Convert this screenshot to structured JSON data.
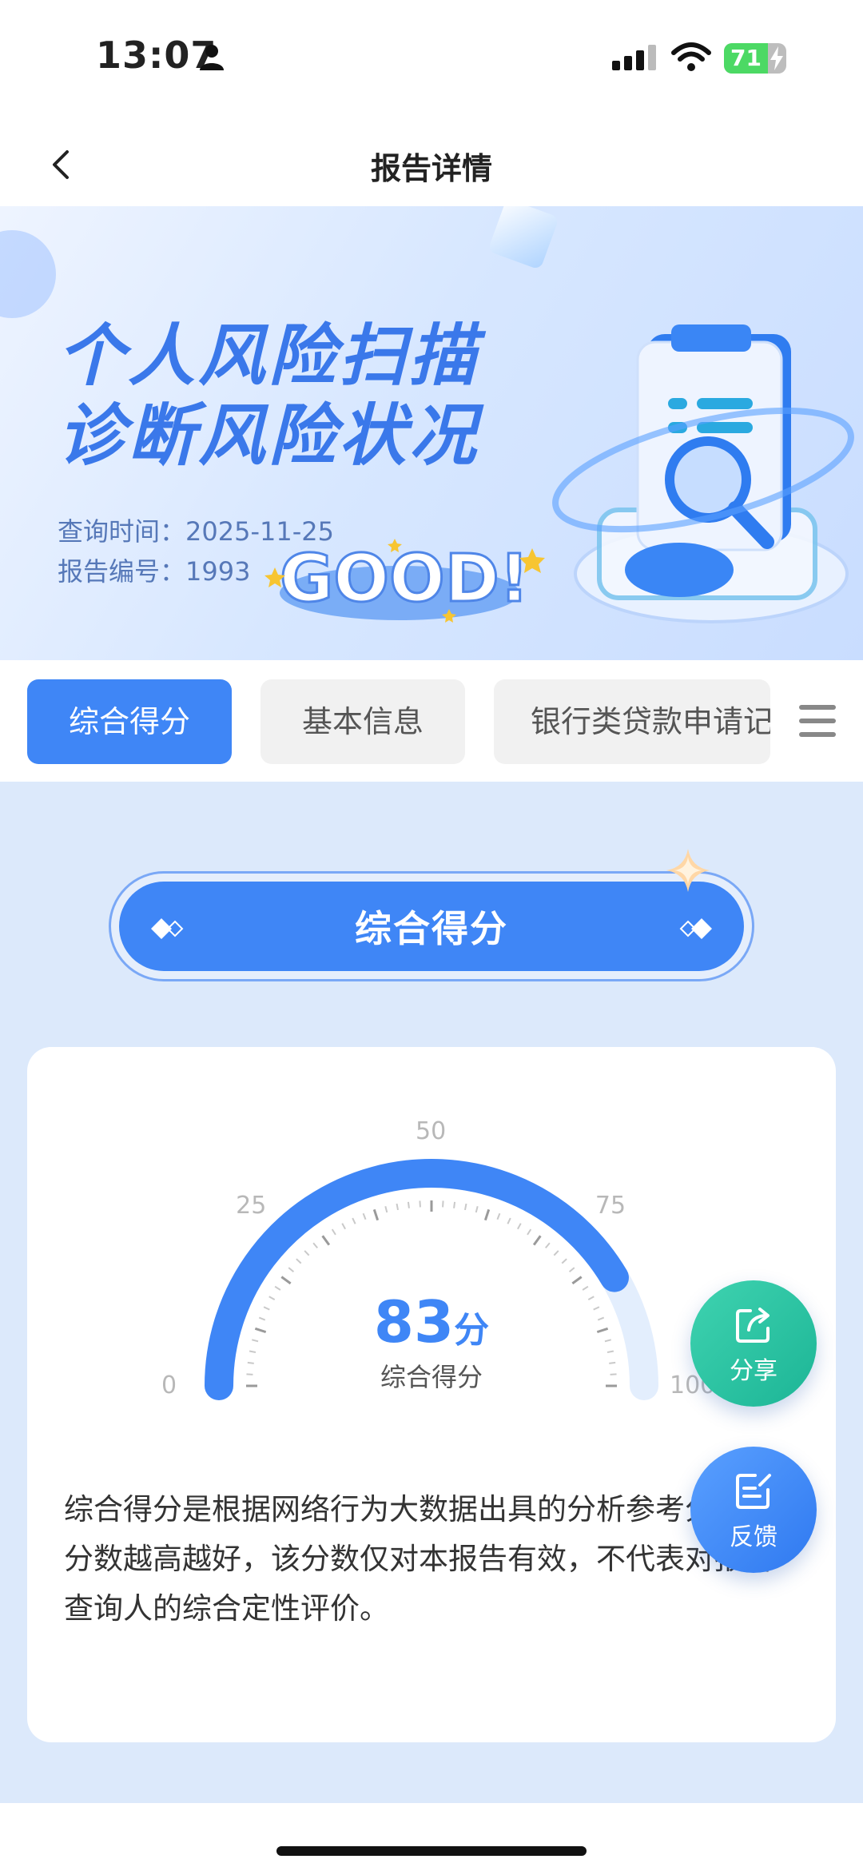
{
  "status_bar": {
    "time": "13:07",
    "battery": "71",
    "battery_level": 0.71
  },
  "nav": {
    "title": "报告详情"
  },
  "banner": {
    "headline_line1": "个人风险扫描",
    "headline_line2": "诊断风险状况",
    "query_time": "查询时间：2025-11-25",
    "report_no": "报告编号：1993",
    "badge_text": "GOOD!"
  },
  "tabs": [
    {
      "label": "综合得分",
      "active": true
    },
    {
      "label": "基本信息",
      "active": false
    },
    {
      "label": "银行类贷款申请记录",
      "active": false
    }
  ],
  "section": {
    "title": "综合得分"
  },
  "gauge": {
    "min": 0,
    "max": 100,
    "value": 83,
    "ticks": [
      "0",
      "25",
      "50",
      "75",
      "100"
    ],
    "unit": "分",
    "label": "综合得分",
    "colors": {
      "fill": "#3f86f6",
      "track": "#e3eefd"
    }
  },
  "description": "综合得分是根据网络行为大数据出具的分析参考分数，分数越高越好，该分数仅对本报告有效，不代表对报告查询人的综合定性评价。",
  "fabs": {
    "share": "分享",
    "feedback": "反馈"
  }
}
